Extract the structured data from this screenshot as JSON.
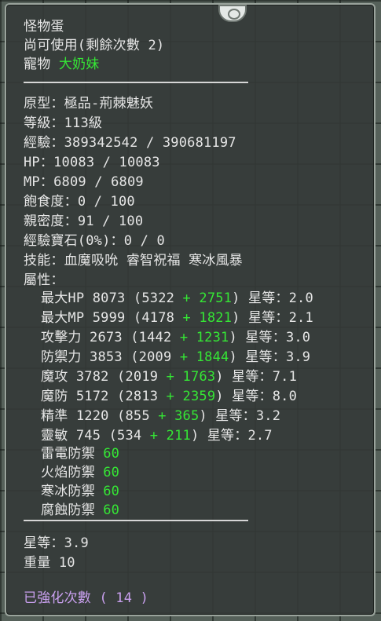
{
  "item": {
    "name": "怪物蛋",
    "usable": "尚可使用(剩餘次數 2)",
    "pet_label": "寵物",
    "pet_name": "大奶妹"
  },
  "stats": {
    "origin_label": "原型：",
    "origin": "極品-荊棘魅妖",
    "level_label": "等級：",
    "level": "113級",
    "exp_label": "經驗：",
    "exp": "389342542 / 390681197",
    "hp_label": "HP：",
    "hp": "10083 / 10083",
    "mp_label": "MP：",
    "mp": "6809 / 6809",
    "satiety_label": "飽食度：",
    "satiety": "0 / 100",
    "intimacy_label": "親密度：",
    "intimacy": "91 / 100",
    "exp_gem_label": "經驗寶石(0%)：",
    "exp_gem": "0 / 0",
    "skills_label": "技能：",
    "skills": "血魔吸吮 睿智祝福 寒冰風暴",
    "attributes_label": "屬性："
  },
  "attributes": [
    {
      "name": "最大HP",
      "value": "8073",
      "base": "(5322",
      "bonus": "+ 2751",
      "grade": ") 星等：2.0"
    },
    {
      "name": "最大MP",
      "value": "5999",
      "base": "(4178",
      "bonus": "+ 1821",
      "grade": ") 星等：2.1"
    },
    {
      "name": "攻擊力",
      "value": "2673",
      "base": "(1442",
      "bonus": "+ 1231",
      "grade": ") 星等：3.0"
    },
    {
      "name": "防禦力",
      "value": "3853",
      "base": "(2009",
      "bonus": "+ 1844",
      "grade": ") 星等：3.9"
    },
    {
      "name": "魔攻",
      "value": "3782",
      "base": "(2019",
      "bonus": "+ 1763",
      "grade": ") 星等：7.1"
    },
    {
      "name": "魔防",
      "value": "5172",
      "base": "(2813",
      "bonus": "+ 2359",
      "grade": ") 星等：8.0"
    },
    {
      "name": "精準",
      "value": "1220",
      "base": "(855",
      "bonus": "+ 365",
      "grade": ") 星等：3.2"
    },
    {
      "name": "靈敏",
      "value": "745",
      "base": "(534",
      "bonus": "+ 211",
      "grade": ") 星等：2.7"
    }
  ],
  "resistances": [
    {
      "name": "雷電防禦",
      "value": "60"
    },
    {
      "name": "火焰防禦",
      "value": "60"
    },
    {
      "name": "寒冰防禦",
      "value": "60"
    },
    {
      "name": "腐蝕防禦",
      "value": "60"
    }
  ],
  "footer": {
    "star_label": "星等：",
    "star": "3.9",
    "weight_label": "重量",
    "weight": "10",
    "enhance_label": "已強化次數",
    "enhance": "( 14 )"
  },
  "colors": {
    "text": "#e6e6e6",
    "bonus_green": "#35e635",
    "enhance_purple": "#c9a0ef",
    "panel_bg": "#343a37"
  }
}
